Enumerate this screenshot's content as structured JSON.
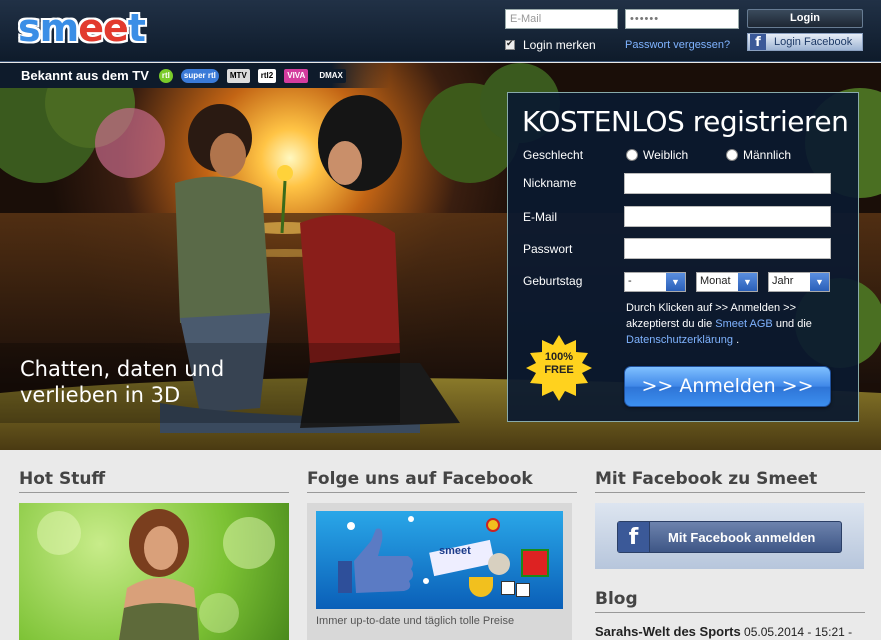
{
  "header": {
    "logo_text_1": "sm",
    "logo_text_2": "ee",
    "logo_text_3": "t",
    "email_placeholder": "E-Mail",
    "password_value": "••••••",
    "login_label": "Login",
    "remember_label": "Login merken",
    "forgot_label": "Passwort vergessen?",
    "fb_login_label": "Login Facebook"
  },
  "tvbar": {
    "label": "Bekannt aus dem TV",
    "logos": [
      "rtl",
      "super rtl",
      "MTV",
      "rtl2",
      "VIVA",
      "DMAX"
    ]
  },
  "hero": {
    "line1": "Chatten, daten und",
    "line2": "verlieben in 3D"
  },
  "registration": {
    "title": "KOSTENLOS registrieren",
    "gender_label": "Geschlecht",
    "gender_female": "Weiblich",
    "gender_male": "Männlich",
    "nickname_label": "Nickname",
    "email_label": "E-Mail",
    "password_label": "Passwort",
    "birthday_label": "Geburtstag",
    "day_value": "-",
    "month_value": "Monat",
    "year_value": "Jahr",
    "terms_1": "Durch Klicken auf >> Anmelden >> akzeptierst du die ",
    "terms_link1": "Smeet AGB",
    "terms_2": " und die ",
    "terms_link2": "Datenschutzerklärung",
    "terms_3": " .",
    "badge_line1": "100%",
    "badge_line2": "FREE",
    "submit_label": ">> Anmelden >>"
  },
  "lower": {
    "hot_title": "Hot Stuff",
    "fb_title": "Folge uns auf Facebook",
    "fb_caption": "Immer up-to-date und täglich tolle Preise",
    "fb_banner_logo": "smeet",
    "mf_title": "Mit Facebook zu Smeet",
    "mf_button": "Mit Facebook anmelden",
    "blog_title": "Blog",
    "blog_entry_title": "Sarahs-Welt des Sports",
    "blog_entry_date": " 05.05.2014 - 15:21 -"
  },
  "colors": {
    "header_bg": "#0e1b2b",
    "accent_blue": "#3a8ee6",
    "logo_red": "#e23a2e",
    "submit_blue": "#3f87e8"
  }
}
